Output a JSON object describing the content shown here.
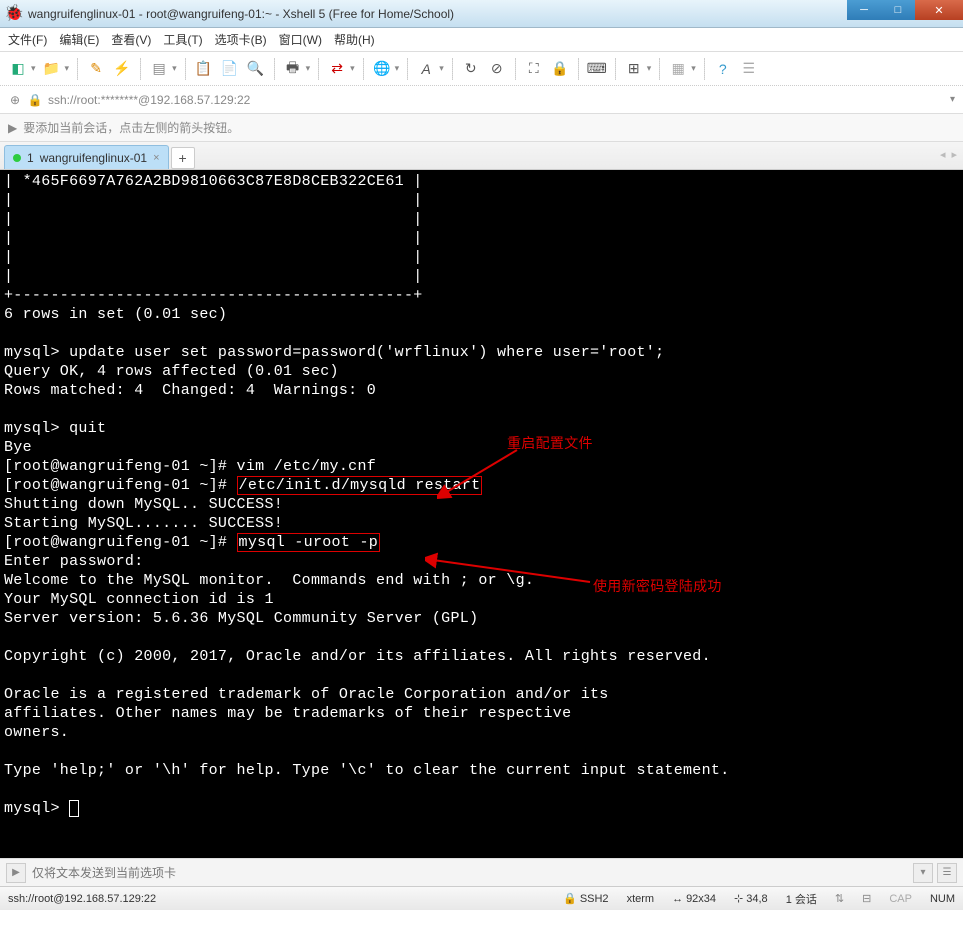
{
  "window": {
    "title": "wangruifenglinux-01 - root@wangruifeng-01:~ - Xshell 5 (Free for Home/School)"
  },
  "menu": {
    "file": "文件(F)",
    "edit": "编辑(E)",
    "view": "查看(V)",
    "tools": "工具(T)",
    "tabs": "选项卡(B)",
    "window": "窗口(W)",
    "help": "帮助(H)"
  },
  "address": {
    "text": "ssh://root:********@192.168.57.129:22"
  },
  "tip": {
    "text": "要添加当前会话，点击左侧的箭头按钮。"
  },
  "tab": {
    "index": "1",
    "label": "wangruifenglinux-01",
    "add": "+"
  },
  "terminal": {
    "l1": "| *465F6697A762A2BD9810663C87E8D8CEB322CE61 |",
    "l2": "|                                           |",
    "l3": "|                                           |",
    "l4": "|                                           |",
    "l5": "|                                           |",
    "l6": "|                                           |",
    "l7": "+-------------------------------------------+",
    "l8": "6 rows in set (0.01 sec)",
    "l9": "",
    "l10": "mysql> update user set password=password('wrflinux') where user='root';",
    "l11": "Query OK, 4 rows affected (0.01 sec)",
    "l12": "Rows matched: 4  Changed: 4  Warnings: 0",
    "l13": "",
    "l14": "mysql> quit",
    "l15": "Bye",
    "l16": "[root@wangruifeng-01 ~]# vim /etc/my.cnf",
    "l17p": "[root@wangruifeng-01 ~]# ",
    "l17b": "/etc/init.d/mysqld restart",
    "l18": "Shutting down MySQL.. SUCCESS!",
    "l19": "Starting MySQL....... SUCCESS!",
    "l20p": "[root@wangruifeng-01 ~]# ",
    "l20b": "mysql -uroot -p",
    "l21": "Enter password:",
    "l22": "Welcome to the MySQL monitor.  Commands end with ; or \\g.",
    "l23": "Your MySQL connection id is 1",
    "l24": "Server version: 5.6.36 MySQL Community Server (GPL)",
    "l25": "",
    "l26": "Copyright (c) 2000, 2017, Oracle and/or its affiliates. All rights reserved.",
    "l27": "",
    "l28": "Oracle is a registered trademark of Oracle Corporation and/or its",
    "l29": "affiliates. Other names may be trademarks of their respective",
    "l30": "owners.",
    "l31": "",
    "l32": "Type 'help;' or '\\h' for help. Type '\\c' to clear the current input statement.",
    "l33": "",
    "l34": "mysql> ",
    "annot1": "重启配置文件",
    "annot2": "使用新密码登陆成功"
  },
  "input": {
    "placeholder": "仅将文本发送到当前选项卡"
  },
  "status": {
    "conn": "ssh://root@192.168.57.129:22",
    "ssh": "SSH2",
    "term": "xterm",
    "size": "92x34",
    "pos": "34,8",
    "sessions": "1 会话",
    "cap": "CAP",
    "num": "NUM"
  }
}
